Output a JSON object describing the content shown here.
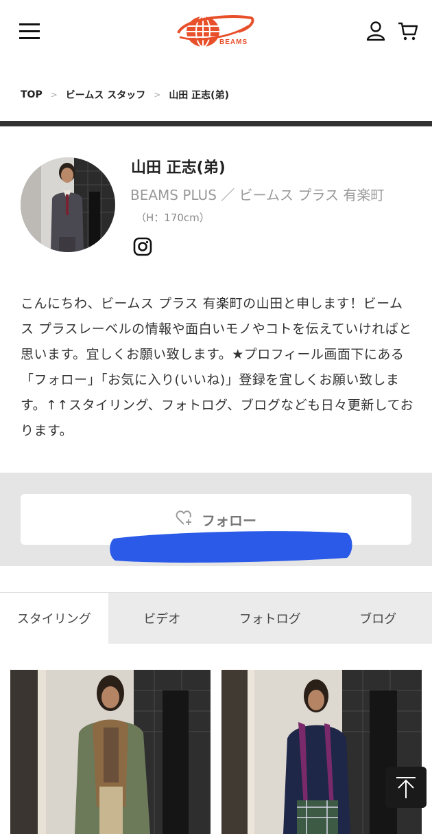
{
  "header": {
    "logo_text": "BEAMS",
    "brand_color": "#e8502b",
    "icons": [
      "hamburger-menu-icon",
      "user-icon",
      "cart-icon"
    ]
  },
  "breadcrumb": {
    "items": [
      "TOP",
      "ビームス スタッフ",
      "山田 正志(弟)"
    ],
    "separator": ">"
  },
  "profile": {
    "name": "山田 正志(弟)",
    "shop": "BEAMS PLUS ／ ビームス プラス 有楽町",
    "height": "（H：170cm）",
    "social_icon": "instagram-icon",
    "intro": "こんにちわ、ビームス プラス 有楽町の山田と申します！ビームス プラスレーベルの情報や面白いモノやコトを伝えていければと思います。宜しくお願い致します。★プロフィール画面下にある「フォロー」「お気に入り(いいね)」登録を宜しくお願い致します。↑↑スタイリング、フォトログ、ブログなども日々更新しております。"
  },
  "follow": {
    "label": "フォロー",
    "icon": "heart-plus-icon"
  },
  "tabs": [
    {
      "label": "スタイリング",
      "active": true
    },
    {
      "label": "ビデオ",
      "active": false
    },
    {
      "label": "フォトログ",
      "active": false
    },
    {
      "label": "ブログ",
      "active": false
    }
  ],
  "back_to_top_icon": "arrow-up-icon"
}
